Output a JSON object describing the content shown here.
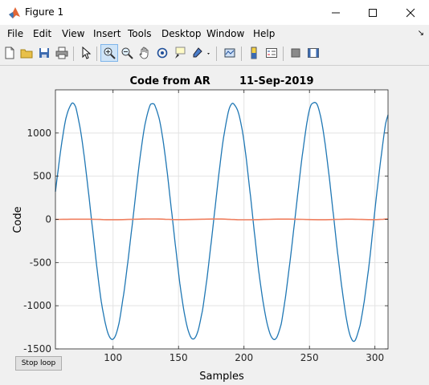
{
  "window": {
    "title": "Figure 1",
    "minimize_icon": "minimize-icon",
    "maximize_icon": "maximize-icon",
    "close_icon": "close-icon"
  },
  "menu": {
    "items": [
      "File",
      "Edit",
      "View",
      "Insert",
      "Tools",
      "Desktop",
      "Window",
      "Help"
    ],
    "overflow_icon": "dock-arrow-icon"
  },
  "toolbar": {
    "icons": [
      "new-figure-icon",
      "open-file-icon",
      "save-icon",
      "print-icon",
      "select-arrow-icon",
      "zoom-in-icon",
      "zoom-out-icon",
      "pan-hand-icon",
      "rotate-3d-icon",
      "data-cursor-icon",
      "brush-icon",
      "link-plot-icon",
      "colorbar-icon",
      "legend-icon",
      "hide-plot-tools-icon",
      "show-plot-tools-icon"
    ],
    "active": "zoom-in-icon"
  },
  "button": {
    "stop_label": "Stop loop"
  },
  "colors": {
    "series_blue": "#1f77b4",
    "series_orange": "#f08060",
    "grid": "#e3e3e3",
    "axes": "#262626"
  },
  "chart_data": {
    "type": "line",
    "title": "Code from AR        11-Sep-2019",
    "xlabel": "Samples",
    "ylabel": "Code",
    "xlim": [
      56,
      310
    ],
    "ylim": [
      -1500,
      1500
    ],
    "xticks": [
      100,
      150,
      200,
      250,
      300
    ],
    "yticks": [
      -1500,
      -1000,
      -500,
      0,
      500,
      1000
    ],
    "grid": true,
    "series": [
      {
        "color": "#1f77b4",
        "x": [
          56,
          60,
          64,
          68,
          70,
          72,
          76,
          80,
          84,
          88,
          90,
          92,
          96,
          100,
          104,
          108,
          110,
          112,
          116,
          120,
          124,
          128,
          130,
          132,
          136,
          140,
          144,
          148,
          150,
          152,
          156,
          160,
          164,
          168,
          170,
          172,
          176,
          180,
          184,
          188,
          190,
          192,
          196,
          200,
          204,
          208,
          210,
          212,
          216,
          220,
          224,
          228,
          230,
          232,
          236,
          240,
          244,
          248,
          250,
          252,
          256,
          260,
          264,
          268,
          270,
          272,
          276,
          280,
          284,
          288,
          290,
          292,
          296,
          300,
          304,
          308,
          310
        ],
        "y": [
          320,
          797,
          1168,
          1333,
          1340,
          1270,
          949,
          477,
          -64,
          -600,
          -841,
          -1042,
          -1313,
          -1388,
          -1239,
          -876,
          -651,
          -403,
          114,
          640,
          1065,
          1311,
          1339,
          1317,
          1112,
          714,
          190,
          -352,
          -614,
          -853,
          -1205,
          -1377,
          -1331,
          -1076,
          -878,
          -650,
          -127,
          416,
          905,
          1241,
          1325,
          1339,
          1221,
          904,
          399,
          -158,
          -434,
          -686,
          -1081,
          -1329,
          -1387,
          -1236,
          -1069,
          -863,
          -378,
          152,
          677,
          1114,
          1270,
          1340,
          1325,
          1072,
          630,
          93,
          -185,
          -452,
          -931,
          -1287,
          -1413,
          -1264,
          -1116,
          -929,
          -463,
          110,
          635,
          1092,
          1210
        ]
      },
      {
        "color": "#f08060",
        "x": [
          56,
          80,
          100,
          130,
          150,
          180,
          200,
          230,
          260,
          280,
          300,
          310
        ],
        "y": [
          0,
          2,
          -4,
          5,
          -3,
          4,
          -5,
          3,
          -4,
          2,
          -3,
          5
        ]
      }
    ]
  }
}
